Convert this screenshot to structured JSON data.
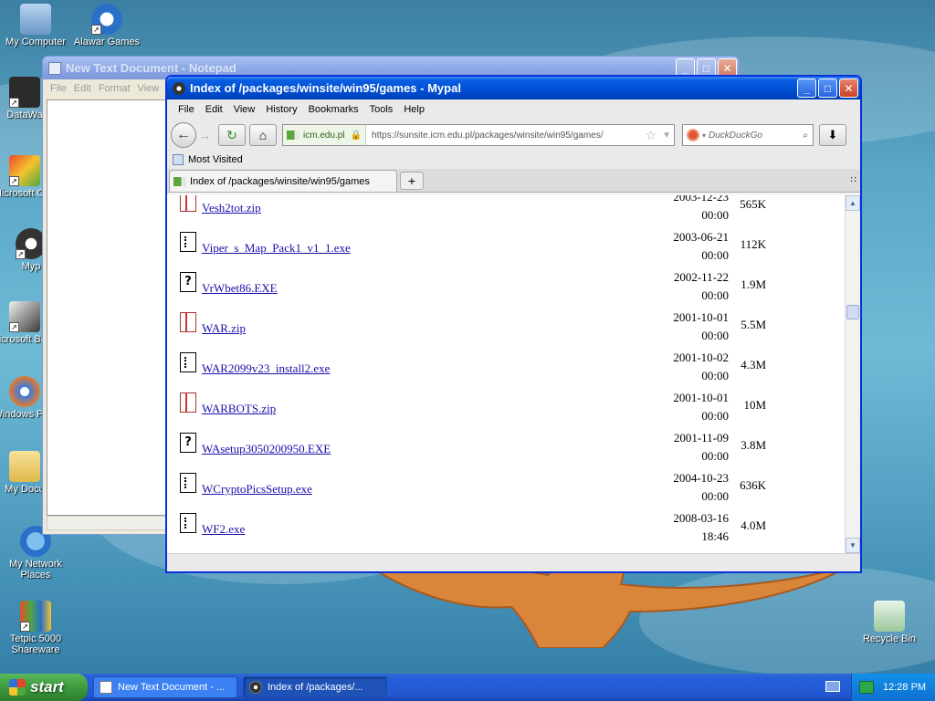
{
  "desktop": {
    "icons": [
      {
        "label": "My Computer",
        "name": "my-computer"
      },
      {
        "label": "Alawar Games",
        "name": "alawar-games"
      },
      {
        "label": "DataWa",
        "name": "datawa"
      },
      {
        "label": "Microsoft C++",
        "name": "microsoft-cpp"
      },
      {
        "label": "Myp",
        "name": "mypal"
      },
      {
        "label": "Microsoft Basic",
        "name": "microsoft-basic"
      },
      {
        "label": "Windows Play",
        "name": "windows-player"
      },
      {
        "label": "My Docu",
        "name": "my-documents"
      },
      {
        "label": "My Network Places",
        "name": "my-network-places"
      },
      {
        "label": "Tetpic 5000 Shareware",
        "name": "tetpic-5000"
      },
      {
        "label": "Recycle Bin",
        "name": "recycle-bin"
      }
    ]
  },
  "notepad": {
    "title": "New Text Document - Notepad",
    "menu": [
      "File",
      "Edit",
      "Format",
      "View"
    ]
  },
  "browser": {
    "title": "Index of /packages/winsite/win95/games - Mypal",
    "menu": [
      "File",
      "Edit",
      "View",
      "History",
      "Bookmarks",
      "Tools",
      "Help"
    ],
    "site_identity": "icm.edu.pl",
    "url": "https://sunsite.icm.edu.pl/packages/winsite/win95/games/",
    "search_placeholder": "DuckDuckGo",
    "bookmarks_toolbar": "Most Visited",
    "tab_title": "Index of /packages/winsite/win95/games",
    "tab_new_label": "+",
    "files": [
      {
        "name": "Vesh2tot.zip",
        "type": "zip",
        "date": "2003-12-23",
        "time": "00:00",
        "size": "565K"
      },
      {
        "name": "Viper_s_Map_Pack1_v1_1.exe",
        "type": "exe",
        "date": "2003-06-21",
        "time": "00:00",
        "size": "112K"
      },
      {
        "name": "VrWbet86.EXE",
        "type": "unknown",
        "date": "2002-11-22",
        "time": "00:00",
        "size": "1.9M"
      },
      {
        "name": "WAR.zip",
        "type": "zip",
        "date": "2001-10-01",
        "time": "00:00",
        "size": "5.5M"
      },
      {
        "name": "WAR2099v23_install2.exe",
        "type": "exe",
        "date": "2001-10-02",
        "time": "00:00",
        "size": "4.3M"
      },
      {
        "name": "WARBOTS.zip",
        "type": "zip",
        "date": "2001-10-01",
        "time": "00:00",
        "size": "10M"
      },
      {
        "name": "WAsetup3050200950.EXE",
        "type": "unknown",
        "date": "2001-11-09",
        "time": "00:00",
        "size": "3.8M"
      },
      {
        "name": "WCryptoPicsSetup.exe",
        "type": "exe",
        "date": "2004-10-23",
        "time": "00:00",
        "size": "636K"
      },
      {
        "name": "WF2.exe",
        "type": "exe",
        "date": "2008-03-16",
        "time": "18:46",
        "size": "4.0M"
      }
    ]
  },
  "taskbar": {
    "start_label": "start",
    "tasks": [
      {
        "label": "New Text Document - ...",
        "active": false
      },
      {
        "label": "Index of /packages/...",
        "active": true
      }
    ],
    "clock": "12:28 PM"
  },
  "colors": {
    "xp_blue": "#0052d6",
    "link": "#1a0dab",
    "start_green": "#3c9a3c"
  }
}
